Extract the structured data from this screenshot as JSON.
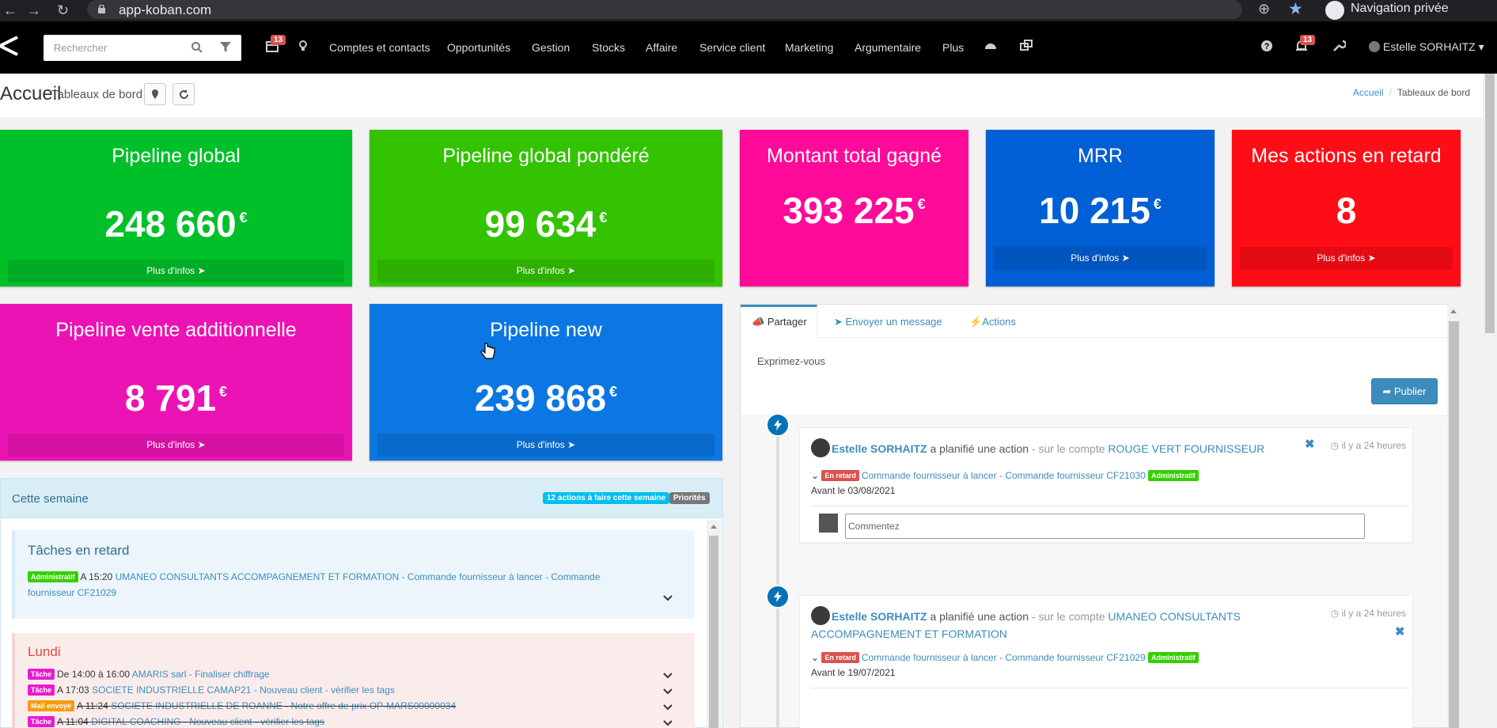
{
  "browser": {
    "url": "app-koban.com",
    "incognito_label": "Navigation privée"
  },
  "nav": {
    "search_placeholder": "Rechercher",
    "calendar_badge": "13",
    "notif_badge": "13",
    "menu": [
      "Comptes et contacts",
      "Opportunités",
      "Gestion",
      "Stocks",
      "Affaire",
      "Service client",
      "Marketing",
      "Argumentaire",
      "Plus"
    ],
    "user": "Estelle SORHAITZ"
  },
  "header": {
    "title": "Accueil",
    "subtitle": "Tableaux de bord",
    "breadcrumb": [
      "Accueil",
      "Tableaux de bord"
    ]
  },
  "boxes": [
    {
      "title": "Pipeline global",
      "value": "248 660",
      "currency": "€",
      "more": "Plus d'infos",
      "color": "#00c02a"
    },
    {
      "title": "Pipeline global pondéré",
      "value": "99 634",
      "currency": "€",
      "more": "Plus d'infos",
      "color": "#33c300"
    },
    {
      "title": "Montant total gagné",
      "value": "393 225",
      "currency": "€",
      "more": "",
      "color": "#ff0a99"
    },
    {
      "title": "MRR",
      "value": "10 215",
      "currency": "€",
      "more": "Plus d'infos",
      "color": "#005fd5"
    },
    {
      "title": "Mes actions en retard",
      "value": "8",
      "currency": "",
      "more": "Plus d'infos",
      "color": "#ff0d17"
    },
    {
      "title": "Pipeline vente additionnelle",
      "value": "8 791",
      "currency": "€",
      "more": "Plus d'infos",
      "color": "#ec13b5"
    },
    {
      "title": "Pipeline new",
      "value": "239 868",
      "currency": "€",
      "more": "Plus d'infos",
      "color": "#0b77e3"
    }
  ],
  "week": {
    "title": "Cette semaine",
    "actions_label": "12 actions à faire cette semaine",
    "priorities_label": "Priorités",
    "late": {
      "title": "Tâches en retard",
      "tag": "Administratif",
      "time": "A 15:20",
      "line1": "UMANEO CONSULTANTS ACCOMPAGNEMENT ET FORMATION - Commande fournisseur à lancer - Commande",
      "line2": "fournisseur CF21029"
    },
    "monday": {
      "title": "Lundi",
      "rows": [
        {
          "tag": "Tâche",
          "time": "De 14:00 à 16:00",
          "text": "AMARIS sarl - Finaliser chiffrage"
        },
        {
          "tag": "Tâche",
          "time": "A 17:03",
          "text": "SOCIETE INDUSTRIELLE CAMAP21 - Nouveau client - vérifier les tags"
        },
        {
          "tag": "Mail envoyé",
          "time": "A 11:24",
          "text": "SOCIETE INDUSTRIELLE DE ROANNE - Notre offre de prix OP-MARS00000034"
        },
        {
          "tag": "Tâche",
          "time": "A 11:04",
          "text": "DIGITAL COACHING - Nouveau client - vérifier les tags"
        }
      ]
    }
  },
  "share": {
    "tabs": [
      "Partager",
      "Envoyer un message",
      "Actions"
    ],
    "placeholder": "Exprimez-vous",
    "publish": "Publier",
    "comment_placeholder": "Commentez",
    "items": [
      {
        "author": "Estelle SORHAITZ",
        "verb": "a planifié une action",
        "context": "- sur le compte",
        "account": "ROUGE VERT FOURNISSEUR",
        "account2": "",
        "time": "il y a 24 heures",
        "status": "En retard",
        "task": "Commande fournisseur à lancer - Commande fournisseur CF21030",
        "category": "Administratif",
        "due": "Avant le 03/08/2021"
      },
      {
        "author": "Estelle SORHAITZ",
        "verb": "a planifié une action",
        "context": "- sur le compte",
        "account": "UMANEO CONSULTANTS",
        "account2": "ACCOMPAGNEMENT ET FORMATION",
        "time": "il y a 24 heures",
        "status": "En retard",
        "task": "Commande fournisseur à lancer - Commande fournisseur CF21029",
        "category": "Administratif",
        "due": "Avant le 19/07/2021"
      }
    ]
  },
  "colors": {
    "tag_admin": "#33d000",
    "tag_task": "#e81ccf",
    "tag_mail": "#f39c12",
    "tag_late": "#d9534f",
    "link": "#3c8dbc"
  }
}
